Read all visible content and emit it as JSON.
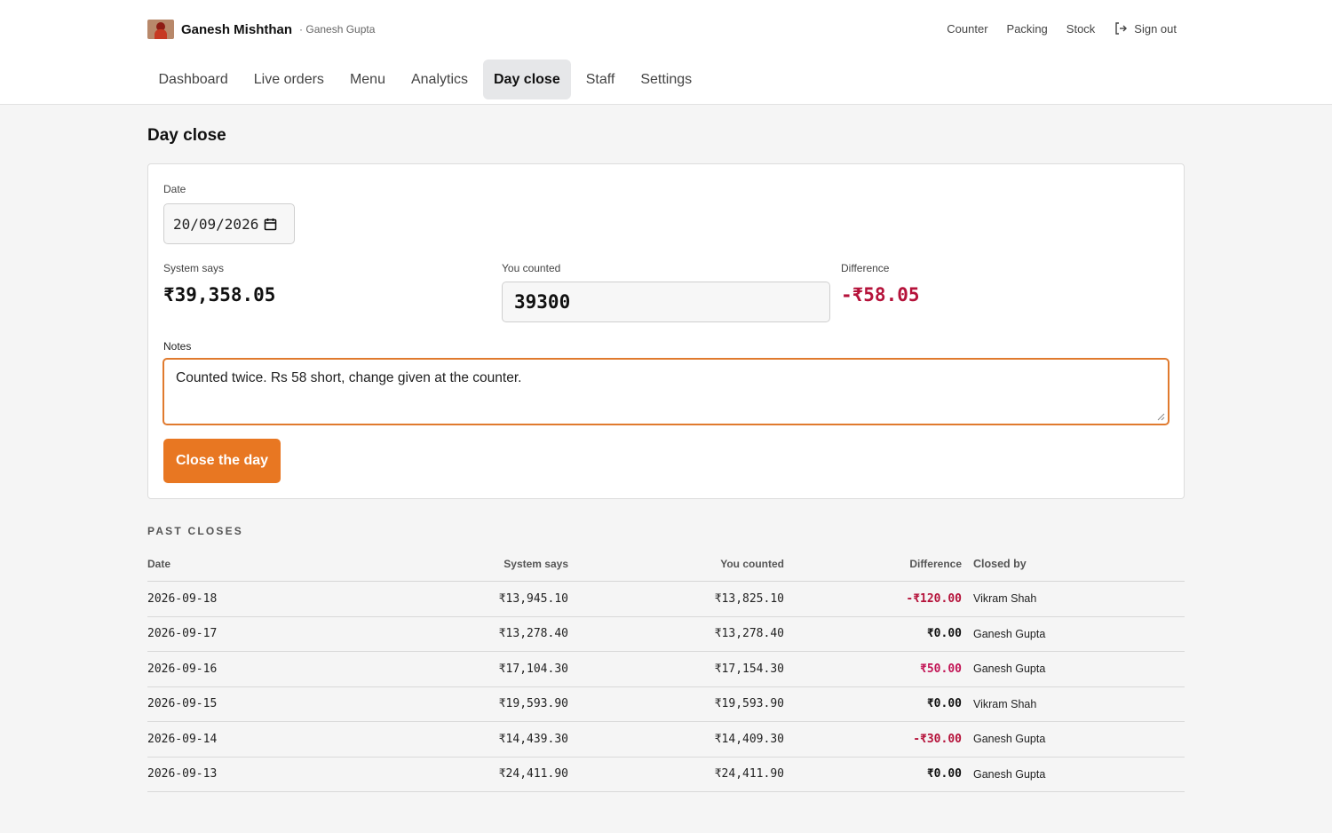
{
  "brand": {
    "name": "Ganesh Mishthan",
    "user": "· Ganesh Gupta"
  },
  "topnav": {
    "counter": "Counter",
    "packing": "Packing",
    "stock": "Stock",
    "signout": "Sign out"
  },
  "tabs": [
    {
      "label": "Dashboard"
    },
    {
      "label": "Live orders"
    },
    {
      "label": "Menu"
    },
    {
      "label": "Analytics"
    },
    {
      "label": "Day close",
      "active": true
    },
    {
      "label": "Staff"
    },
    {
      "label": "Settings"
    }
  ],
  "page": {
    "title": "Day close"
  },
  "form": {
    "date_label": "Date",
    "date_value": "20/09/2026",
    "system_label": "System says",
    "system_value": "₹39,358.05",
    "counted_label": "You counted",
    "counted_value": "39300",
    "diff_label": "Difference",
    "diff_value": "-₹58.05",
    "notes_label": "Notes",
    "notes_value": "Counted twice. Rs 58 short, change given at the counter.",
    "submit_label": "Close the day"
  },
  "past": {
    "title": "PAST CLOSES",
    "headers": {
      "date": "Date",
      "system": "System says",
      "counted": "You counted",
      "diff": "Difference",
      "by": "Closed by"
    },
    "rows": [
      {
        "date": "2026-09-18",
        "system": "₹13,945.10",
        "counted": "₹13,825.10",
        "diff": "-₹120.00",
        "by": "Vikram Shah"
      },
      {
        "date": "2026-09-17",
        "system": "₹13,278.40",
        "counted": "₹13,278.40",
        "diff": "₹0.00",
        "by": "Ganesh Gupta"
      },
      {
        "date": "2026-09-16",
        "system": "₹17,104.30",
        "counted": "₹17,154.30",
        "diff": "₹50.00",
        "by": "Ganesh Gupta"
      },
      {
        "date": "2026-09-15",
        "system": "₹19,593.90",
        "counted": "₹19,593.90",
        "diff": "₹0.00",
        "by": "Vikram Shah"
      },
      {
        "date": "2026-09-14",
        "system": "₹14,439.30",
        "counted": "₹14,409.30",
        "diff": "-₹30.00",
        "by": "Ganesh Gupta"
      },
      {
        "date": "2026-09-13",
        "system": "₹24,411.90",
        "counted": "₹24,411.90",
        "diff": "₹0.00",
        "by": "Ganesh Gupta"
      }
    ]
  },
  "colors": {
    "accent": "#e87722",
    "negative": "#b5123a",
    "positive": "#c21455"
  },
  "icons": {
    "date": "calendar-icon",
    "signout": "sign-out-icon"
  }
}
